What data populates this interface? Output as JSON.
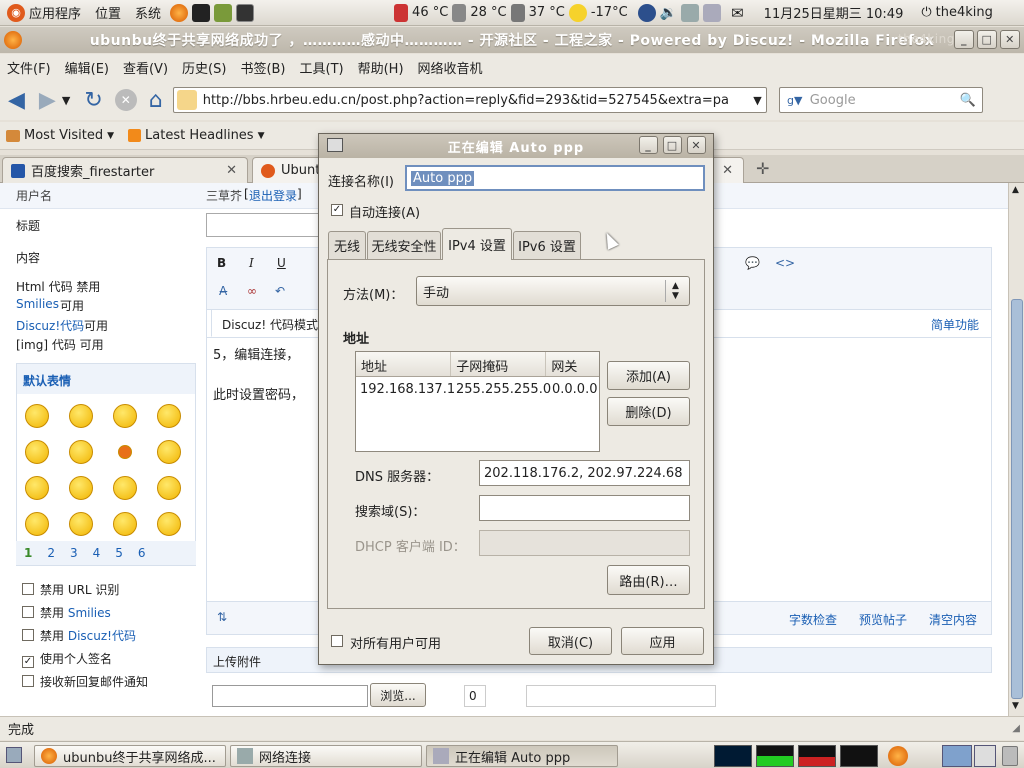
{
  "panel": {
    "apps": "应用程序",
    "places": "位置",
    "system": "系统",
    "temps": [
      "46 °C",
      "28 °C",
      "37 °C"
    ],
    "weather": "-17°C",
    "datetime": "11月25日星期三 10:49",
    "user": "the4king"
  },
  "firefox": {
    "title": "ubunbu终于共享网络成功了 ，…………感动中………… - 开源社区 - 工程之家 - Powered by Discuz! - Mozilla Firefox",
    "title_shadow": "the4king",
    "menus": [
      "文件(F)",
      "编辑(E)",
      "查看(V)",
      "历史(S)",
      "书签(B)",
      "工具(T)",
      "帮助(H)",
      "网络收音机"
    ],
    "url": "http://bbs.hrbeu.edu.cn/post.php?action=reply&fid=293&tid=527545&extra=pa",
    "search_placeholder": "Google",
    "bookmarks": [
      "Most Visited",
      "Latest Headlines"
    ],
    "tabs": [
      "百度搜索_firestarter",
      "Ubuntu"
    ],
    "status": "完成"
  },
  "forum": {
    "user_label": "用户名",
    "user_value": "三草芥",
    "logout": "退出登录",
    "subject_label": "标题",
    "content_label": "内容",
    "html_code": "Html 代码 禁用",
    "smilies_link": "Smilies",
    "smilies_state": "可用",
    "discuz_link": "Discuz!代码",
    "discuz_state": "可用",
    "img_code": "[img] 代码 可用",
    "default_faces": "默认表情",
    "pages": [
      "1",
      "2",
      "3",
      "4",
      "5",
      "6"
    ],
    "options": [
      "禁用 URL 识别",
      "禁用 ",
      "禁用 ",
      "使用个人签名",
      "接收新回复邮件通知"
    ],
    "opt_smilies": "Smilies",
    "opt_discuz": "Discuz!代码",
    "editor_mode_tab": "Discuz! 代码模式",
    "simple_func": "简单功能",
    "editor_line1": "5，编辑连接，",
    "editor_line2": "此时设置密码，",
    "spell_check": "字数检查",
    "preview": "预览帖子",
    "clear": "清空内容",
    "upload": "上传附件",
    "browse": "浏览...",
    "attach_num": "0"
  },
  "dialog": {
    "title": "正在编辑 Auto ppp",
    "conn_name_label": "连接名称(I)",
    "conn_name": "Auto ppp",
    "auto_connect": "自动连接(A)",
    "tabs": [
      "无线",
      "无线安全性",
      "IPv4 设置",
      "IPv6 设置"
    ],
    "method_label": "方法(M)：",
    "method_value": "手动",
    "address_heading": "地址",
    "cols": [
      "地址",
      "子网掩码",
      "网关"
    ],
    "rows": [
      [
        "192.168.137.1",
        "255.255.255.0",
        "0.0.0.0"
      ]
    ],
    "add": "添加(A)",
    "delete": "删除(D)",
    "dns_label": "DNS 服务器：",
    "dns_value": "202.118.176.2, 202.97.224.68",
    "search_label": "搜索域(S)：",
    "dhcp_label": "DHCP 客户端 ID：",
    "routes": "路由(R)…",
    "all_users": "对所有用户可用",
    "cancel": "取消(C)",
    "apply": "应用"
  },
  "taskbar": {
    "items": [
      "ubunbu终于共享网络成...",
      "网络连接",
      "正在编辑 Auto ppp"
    ]
  }
}
